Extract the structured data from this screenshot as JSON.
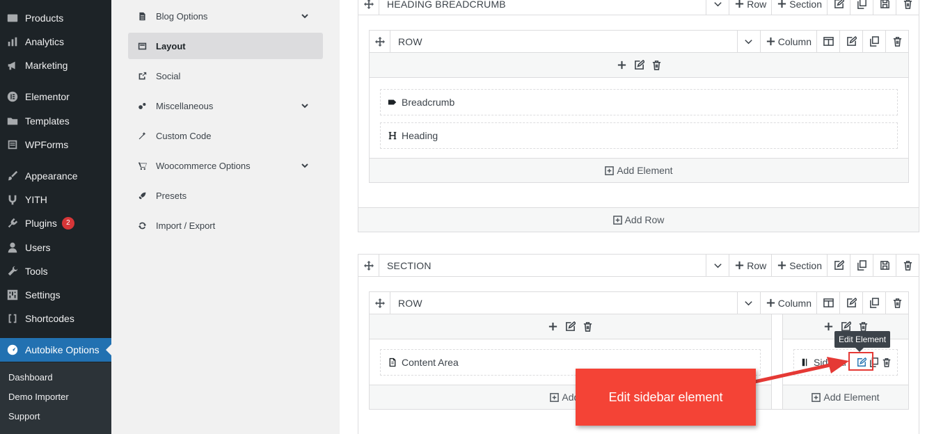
{
  "wp_menu": {
    "items": [
      {
        "label": "Products",
        "icon": "products-icon"
      },
      {
        "label": "Analytics",
        "icon": "analytics-icon"
      },
      {
        "label": "Marketing",
        "icon": "megaphone-icon"
      },
      {
        "label": "Elementor",
        "icon": "elementor-icon"
      },
      {
        "label": "Templates",
        "icon": "folder-icon"
      },
      {
        "label": "WPForms",
        "icon": "wpforms-icon"
      },
      {
        "label": "Appearance",
        "icon": "brush-icon"
      },
      {
        "label": "YITH",
        "icon": "yith-icon"
      },
      {
        "label": "Plugins",
        "icon": "plugin-icon",
        "badge": "2"
      },
      {
        "label": "Users",
        "icon": "user-icon"
      },
      {
        "label": "Tools",
        "icon": "wrench-icon"
      },
      {
        "label": "Settings",
        "icon": "settings-icon"
      },
      {
        "label": "Shortcodes",
        "icon": "brackets-icon"
      },
      {
        "label": "Autobike Options",
        "icon": "autobike-icon",
        "active": true
      }
    ],
    "submenu": [
      "Dashboard",
      "Demo Importer",
      "Support"
    ]
  },
  "options_panel": {
    "items": [
      {
        "label": "Blog Options",
        "icon": "document-icon",
        "has_caret": true
      },
      {
        "label": "Layout",
        "icon": "layout-icon",
        "selected": true
      },
      {
        "label": "Social",
        "icon": "share-icon"
      },
      {
        "label": "Miscellaneous",
        "icon": "gears-icon",
        "has_caret": true
      },
      {
        "label": "Custom Code",
        "icon": "magic-wand-icon"
      },
      {
        "label": "Woocommerce Options",
        "icon": "cart-icon",
        "has_caret": true
      },
      {
        "label": "Presets",
        "icon": "rocket-icon"
      },
      {
        "label": "Import / Export",
        "icon": "sync-icon"
      }
    ]
  },
  "builder": {
    "section1": {
      "title": "HEADING BREADCRUMB",
      "row_btn": "Row",
      "section_btn": "Section",
      "row": {
        "title": "ROW",
        "column_btn": "Column",
        "elements": [
          "Breadcrumb",
          "Heading"
        ],
        "add_element": "Add Element"
      },
      "add_row": "Add Row"
    },
    "section2": {
      "title": "SECTION",
      "row_btn": "Row",
      "section_btn": "Section",
      "row": {
        "title": "ROW",
        "column_btn": "Column",
        "left_element": "Content Area",
        "right_element": "Sidebar",
        "add_element_left": "Add El",
        "add_element_right": "Add Element"
      }
    },
    "tooltip": "Edit Element",
    "callout": "Edit sidebar element",
    "accent_color": "#2271b1",
    "callout_color": "#f44336"
  }
}
